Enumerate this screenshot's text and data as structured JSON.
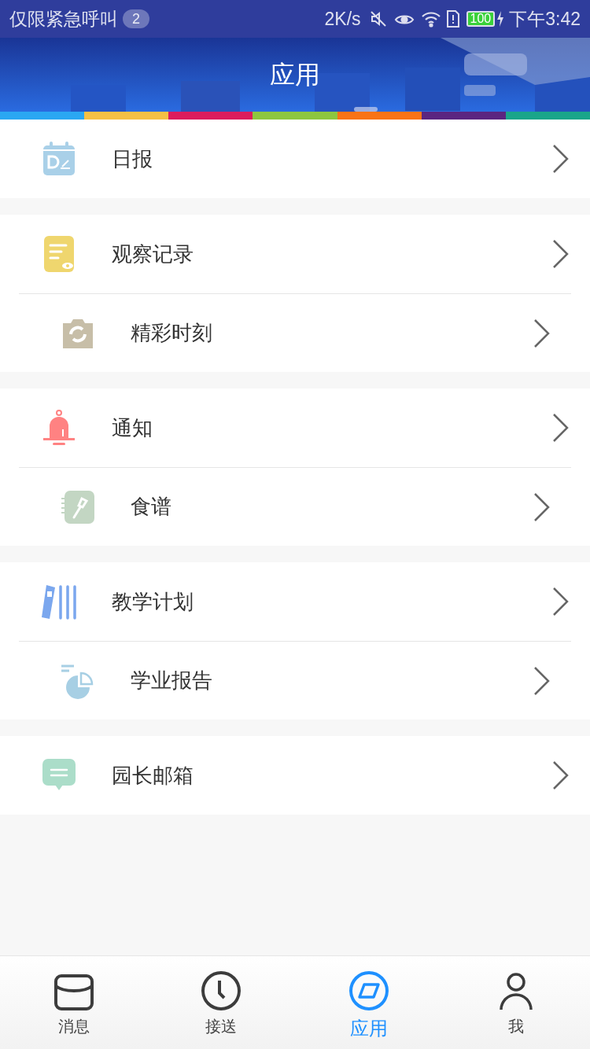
{
  "status_bar": {
    "carrier": "仅限紧急呼叫",
    "badge": "2",
    "speed": "2K/s",
    "battery": "100",
    "time": "下午3:42"
  },
  "header": {
    "title": "应用"
  },
  "groups": [
    {
      "items": [
        {
          "label": "日报"
        }
      ]
    },
    {
      "items": [
        {
          "label": "观察记录"
        },
        {
          "label": "精彩时刻"
        }
      ]
    },
    {
      "items": [
        {
          "label": "通知"
        },
        {
          "label": "食谱"
        }
      ]
    },
    {
      "items": [
        {
          "label": "教学计划"
        },
        {
          "label": "学业报告"
        }
      ]
    },
    {
      "items": [
        {
          "label": "园长邮箱"
        }
      ]
    }
  ],
  "tab_bar": [
    {
      "label": "消息",
      "selected": false
    },
    {
      "label": "接送",
      "selected": false
    },
    {
      "label": "应用",
      "selected": true
    },
    {
      "label": "我",
      "selected": false
    }
  ]
}
